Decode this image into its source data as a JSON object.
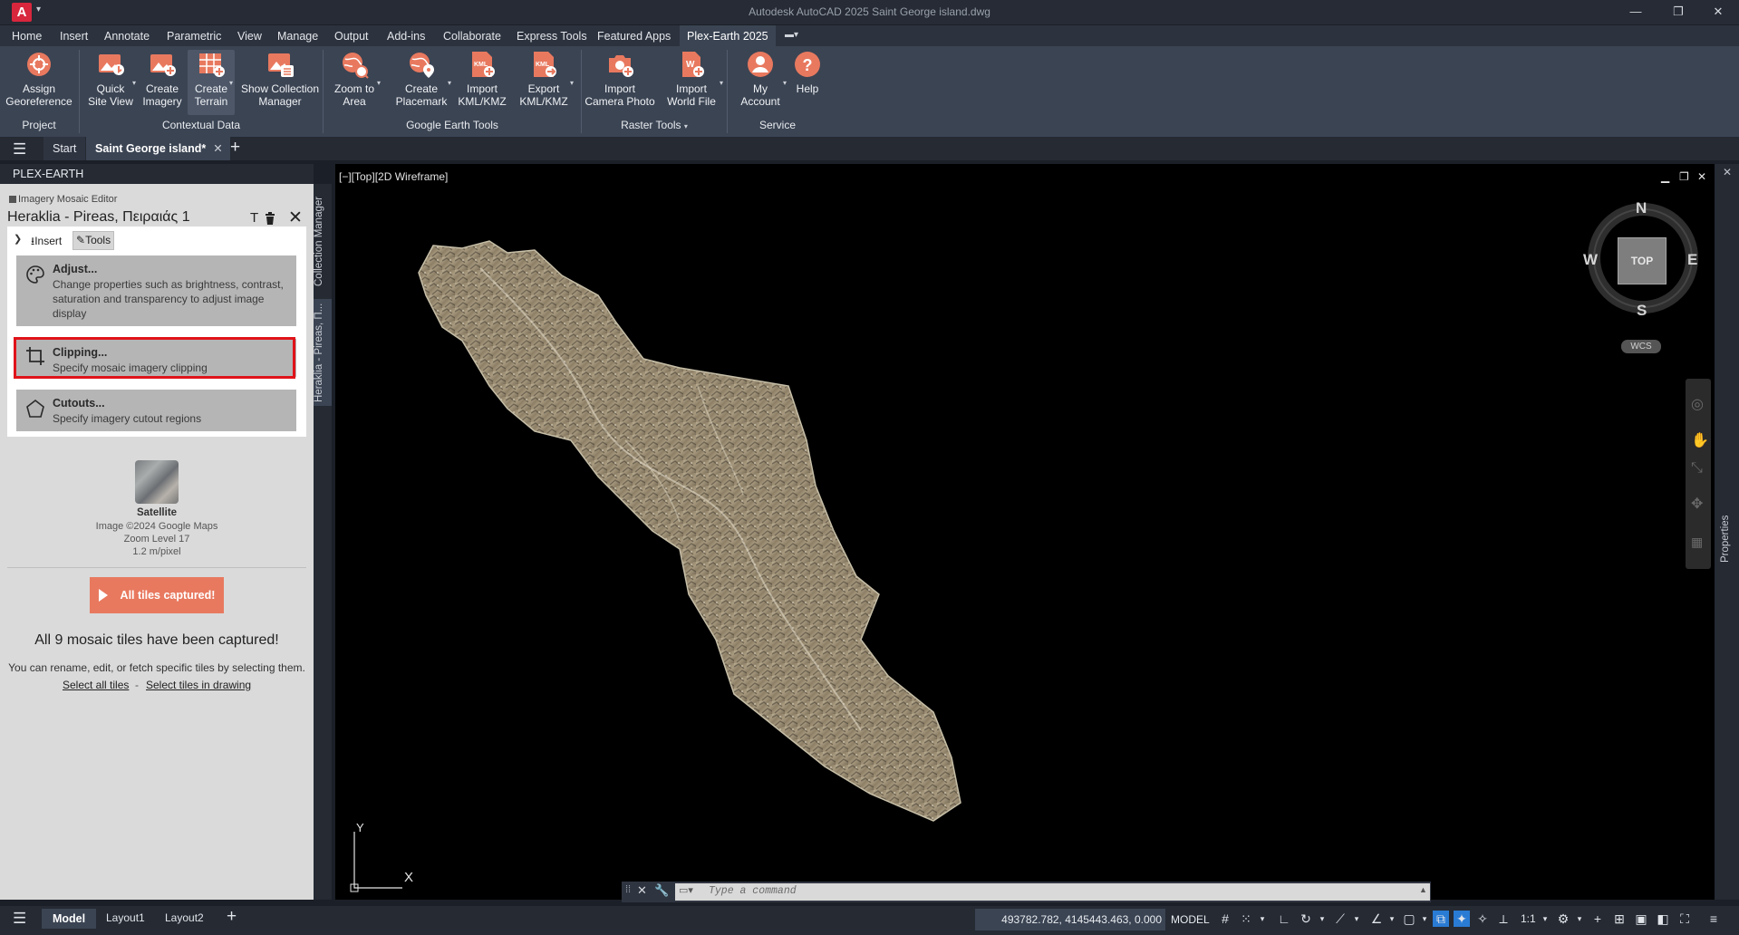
{
  "titlebar": {
    "logo": "A",
    "title": "Autodesk AutoCAD 2025    Saint George island.dwg",
    "minimize": "—",
    "restore": "❐",
    "close": "✕"
  },
  "ribbon_tabs": [
    "Home",
    "Insert",
    "Annotate",
    "Parametric",
    "View",
    "Manage",
    "Output",
    "Add-ins",
    "Collaborate",
    "Express Tools",
    "Featured Apps",
    "Plex-Earth 2025"
  ],
  "ribbon": {
    "buttons": [
      {
        "label": "Assign\nGeoreference",
        "icon": "georeference-icon"
      },
      {
        "label": "Quick\nSite View",
        "icon": "site-view-icon"
      },
      {
        "label": "Create\nImagery",
        "icon": "create-imagery-icon"
      },
      {
        "label": "Create\nTerrain",
        "icon": "create-terrain-icon"
      },
      {
        "label": "Show Collection\nManager",
        "icon": "collection-manager-icon"
      },
      {
        "label": "Zoom to\nArea",
        "icon": "zoom-area-icon"
      },
      {
        "label": "Create\nPlacemark",
        "icon": "placemark-icon"
      },
      {
        "label": "Import\nKML/KMZ",
        "icon": "import-kml-icon"
      },
      {
        "label": "Export\nKML/KMZ",
        "icon": "export-kml-icon"
      },
      {
        "label": "Import\nCamera Photo",
        "icon": "camera-photo-icon"
      },
      {
        "label": "Import\nWorld File",
        "icon": "world-file-icon"
      },
      {
        "label": "My\nAccount",
        "icon": "account-icon"
      },
      {
        "label": "Help",
        "icon": "help-icon"
      }
    ],
    "panels": [
      "Project",
      "Contextual Data",
      "Google Earth Tools",
      "Raster Tools",
      "Service"
    ],
    "accent": "#e8795f"
  },
  "filetabs": {
    "start": "Start",
    "drawing": "Saint George island*",
    "close": "✕",
    "plus": "+"
  },
  "palette": {
    "title": "PLEX-EARTH",
    "editor_label": "Imagery Mosaic Editor",
    "project_title": "Heraklia - Pireas, Πειραιάς 1",
    "side_tabs": [
      "Collection Manager",
      "Heraklia - Pireas, Π..."
    ],
    "tab_insert": "Insert",
    "tab_tools": "Tools",
    "tools": [
      {
        "title": "Adjust...",
        "desc": "Change properties such as brightness, contrast, saturation and transparency to adjust image display"
      },
      {
        "title": "Clipping...",
        "desc": "Specify mosaic imagery clipping"
      },
      {
        "title": "Cutouts...",
        "desc": "Specify imagery cutout regions"
      }
    ],
    "provider": {
      "name": "Satellite",
      "credit": "Image ©2024 Google Maps",
      "zoom": "Zoom Level 17",
      "resolution": "1.2 m/pixel"
    },
    "capture_button": "All tiles captured!",
    "captured_title": "All 9 mosaic tiles have been captured!",
    "captured_desc": "You can rename, edit, or fetch specific tiles by selecting them.",
    "link_select_all": "Select all tiles",
    "link_sep": "-",
    "link_select_drawing": "Select tiles in drawing"
  },
  "viewport": {
    "label": "[−][Top][2D Wireframe]",
    "viewcube": {
      "n": "N",
      "s": "S",
      "e": "E",
      "w": "W",
      "face": "TOP",
      "wcs": "WCS"
    },
    "ucs": {
      "x": "X",
      "y": "Y"
    },
    "right_tab": "Properties"
  },
  "command": {
    "placeholder": "Type a command"
  },
  "statusbar": {
    "model_tab": "Model",
    "layout1": "Layout1",
    "layout2": "Layout2",
    "plus": "+",
    "coords": "493782.782, 4145443.463, 0.000",
    "model": "MODEL",
    "scale": "1:1"
  }
}
